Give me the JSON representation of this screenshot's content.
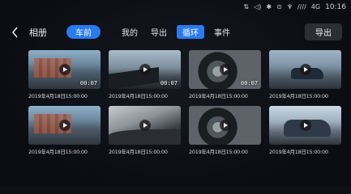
{
  "status_bar": {
    "icons": [
      "network-sharing-icon",
      "volume-icon",
      "bluetooth-icon",
      "location-icon",
      "microphone-icon"
    ],
    "signal_label": "////",
    "network": "4G",
    "time": "10:16"
  },
  "header": {
    "back_icon": "chevron-left-icon",
    "title": "相册",
    "active_chip": "车前",
    "tabs": [
      {
        "label": "我的"
      },
      {
        "label": "导出"
      },
      {
        "label": "循环"
      },
      {
        "label": "事件"
      }
    ],
    "export_label": "导出"
  },
  "grid": {
    "items": [
      {
        "scene": "street",
        "duration": "00:07",
        "date": "2019年4月18日15:00:00"
      },
      {
        "scene": "road",
        "duration": "00:07",
        "date": "2019年4月18日15:00:00"
      },
      {
        "scene": "wheel",
        "duration": "00:07",
        "date": "2019年4月18日15:00:00"
      },
      {
        "scene": "car",
        "duration": "",
        "date": "2019年4月18日15:00:00"
      },
      {
        "scene": "street",
        "duration": "",
        "date": "2019年4月18日15:00:00"
      },
      {
        "scene": "interior",
        "duration": "",
        "date": "2019年4月18日15:00:00"
      },
      {
        "scene": "wheel",
        "duration": "",
        "date": "2019年4月18日15:00:00"
      },
      {
        "scene": "car2",
        "duration": "",
        "date": "2019年4月18日15:00:00"
      }
    ]
  },
  "colors": {
    "accent": "#2a7af0",
    "background": "#0b0d12",
    "button_bg": "#2b2e35"
  }
}
